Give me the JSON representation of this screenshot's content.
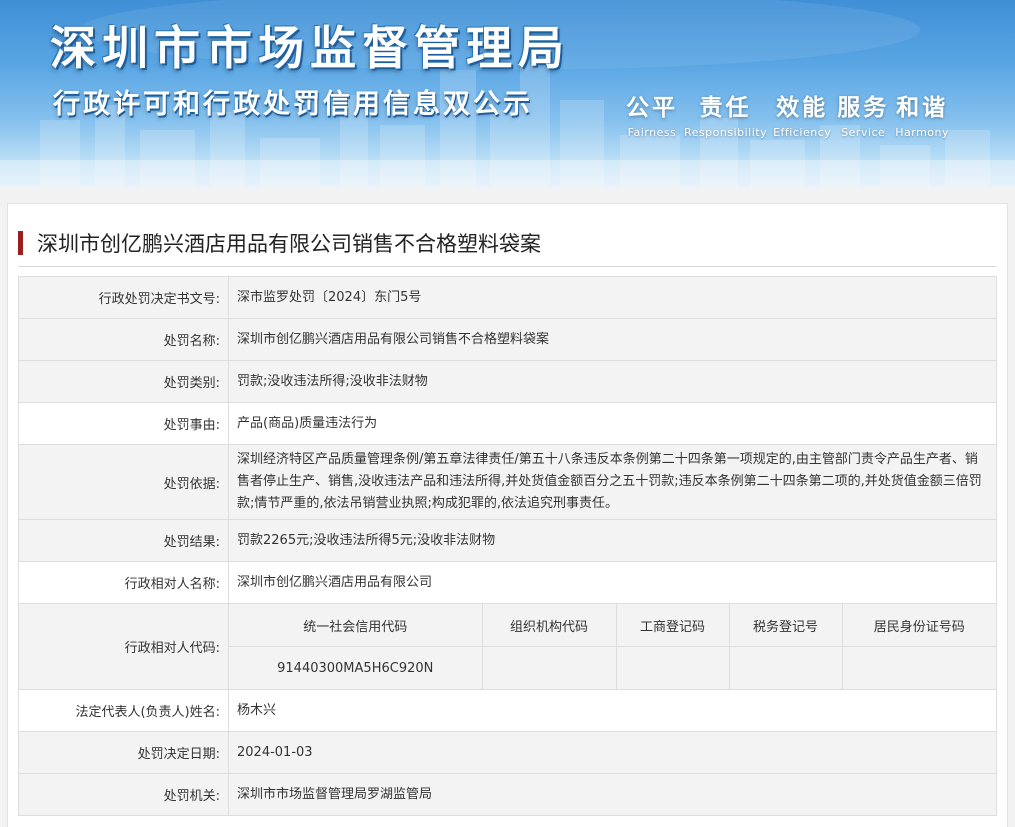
{
  "banner": {
    "title": "深圳市市场监督管理局",
    "subtitle": "行政许可和行政处罚信用信息双公示",
    "slogans": [
      {
        "cn": "公平",
        "en": "Fairness"
      },
      {
        "cn": "责任",
        "en": "Responsibility"
      },
      {
        "cn": "效能",
        "en": "Efficiency"
      },
      {
        "cn": "服务",
        "en": "Service"
      },
      {
        "cn": "和谐",
        "en": "Harmony"
      }
    ]
  },
  "case": {
    "title": "深圳市创亿鹏兴酒店用品有限公司销售不合格塑料袋案",
    "accent_color": "#9a1f1f"
  },
  "rows": {
    "decision_no": {
      "label": "行政处罚决定书文号:",
      "value": "深市监罗处罚〔2024〕东门5号"
    },
    "penalty_name": {
      "label": "处罚名称:",
      "value": "深圳市创亿鹏兴酒店用品有限公司销售不合格塑料袋案"
    },
    "penalty_type": {
      "label": "处罚类别:",
      "value": "罚款;没收违法所得;没收非法财物"
    },
    "penalty_reason": {
      "label": "处罚事由:",
      "value": "产品(商品)质量违法行为"
    },
    "penalty_basis": {
      "label": "处罚依据:",
      "value": "深圳经济特区产品质量管理条例/第五章法律责任/第五十八条违反本条例第二十四条第一项规定的,由主管部门责令产品生产者、销售者停止生产、销售,没收违法产品和违法所得,并处货值金额百分之五十罚款;违反本条例第二十四条第二项的,并处货值金额三倍罚款;情节严重的,依法吊销营业执照;构成犯罪的,依法追究刑事责任。"
    },
    "penalty_result": {
      "label": "处罚结果:",
      "value": "罚款2265元;没收违法所得5元;没收非法财物"
    },
    "party_name": {
      "label": "行政相对人名称:",
      "value": "深圳市创亿鹏兴酒店用品有限公司"
    },
    "party_code": {
      "label": "行政相对人代码:",
      "headers": [
        "统一社会信用代码",
        "组织机构代码",
        "工商登记码",
        "税务登记号",
        "居民身份证号码"
      ],
      "values": [
        "91440300MA5H6C920N",
        "",
        "",
        "",
        ""
      ]
    },
    "legal_rep": {
      "label": "法定代表人(负责人)姓名:",
      "value": "杨木兴"
    },
    "decision_date": {
      "label": "处罚决定日期:",
      "value": "2024-01-03"
    },
    "authority": {
      "label": "处罚机关:",
      "value": "深圳市市场监督管理局罗湖监管局"
    }
  }
}
